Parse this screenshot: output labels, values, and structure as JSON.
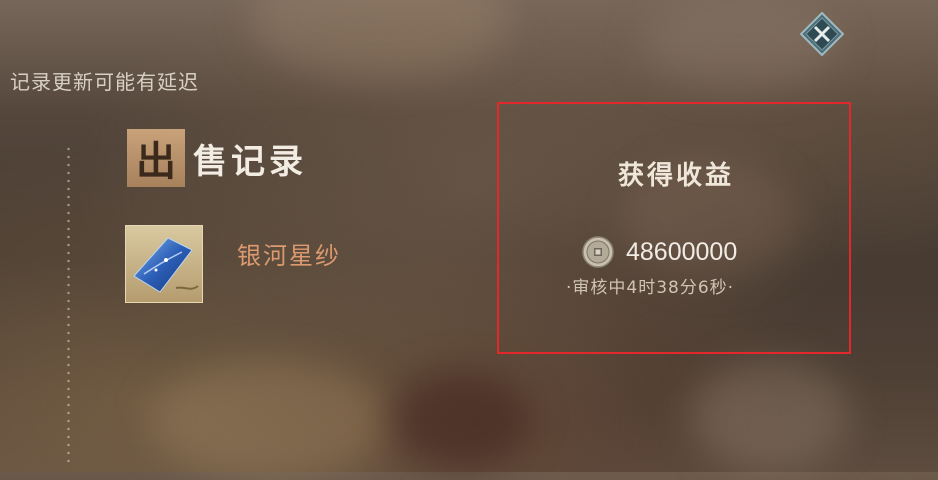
{
  "notice": "记录更新可能有延迟",
  "panel": {
    "title_first_char": "出",
    "title_rest": "售记录"
  },
  "item": {
    "name": "银河星纱",
    "icon": "galaxy-star-gauze-icon"
  },
  "earnings": {
    "title": "获得收益",
    "amount": "48600000",
    "currency_icon": "copper-coin-icon",
    "status": "·审核中4时38分6秒·"
  },
  "colors": {
    "highlight_border": "#e2282b",
    "item_name": "#dc9a70",
    "title_badge": "#b89069"
  },
  "close_icon": "close-x-diamond-icon"
}
